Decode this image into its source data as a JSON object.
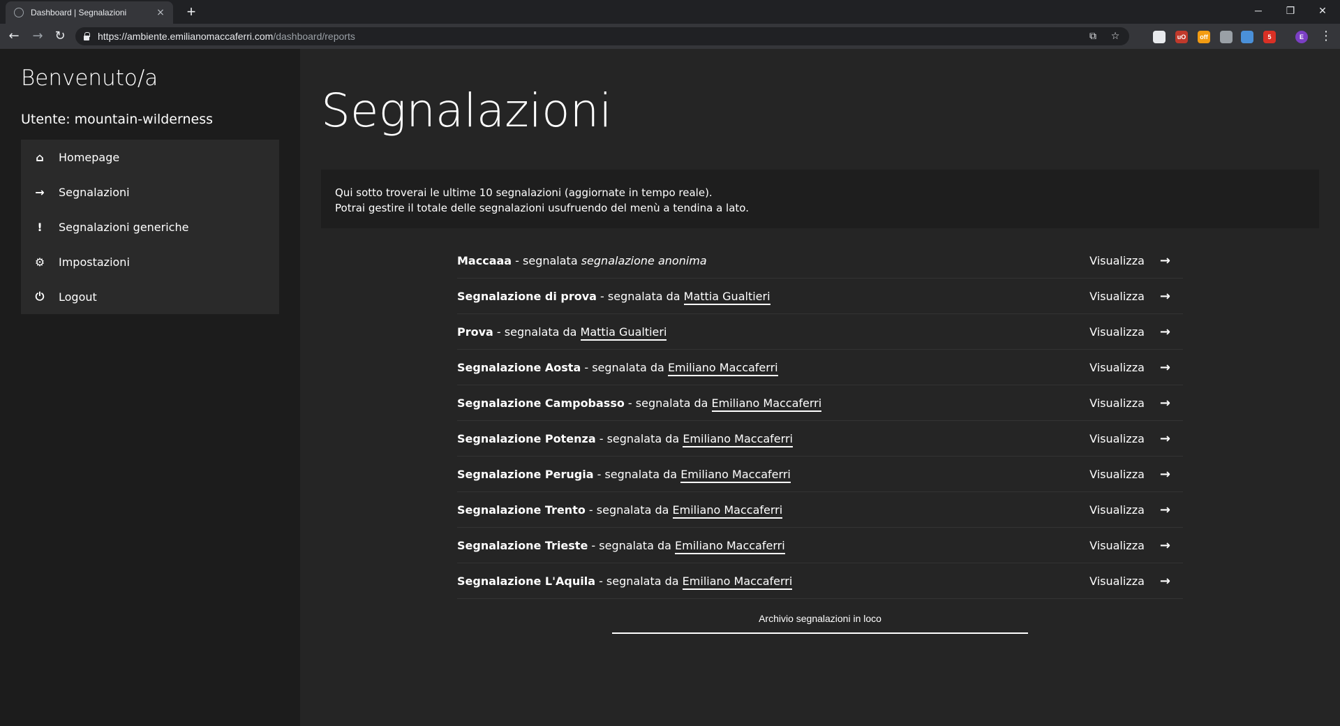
{
  "browser": {
    "tab_title": "Dashboard | Segnalazioni",
    "tab_close": "×",
    "new_tab": "+",
    "url_host": "https://ambiente.emilianomaccaferri.com",
    "url_path": "/dashboard/reports",
    "window_minimize": "─",
    "window_restore": "❐",
    "window_close": "✕",
    "extensions": [
      {
        "label": "",
        "color": "#e8eaed"
      },
      {
        "label": "uO",
        "color": "#c0392b"
      },
      {
        "label": "off",
        "color": "#f39c12"
      },
      {
        "label": "",
        "color": "#9aa0a6"
      },
      {
        "label": "",
        "color": "#4a90d9"
      },
      {
        "label": "5",
        "color": "#d93025"
      },
      {
        "label": "E",
        "color": "#7b3fc4"
      }
    ]
  },
  "sidebar": {
    "welcome": "Benvenuto/a",
    "user": "Utente: mountain-wilderness",
    "menu": [
      {
        "label": "Homepage",
        "icon": "⌂"
      },
      {
        "label": "Segnalazioni",
        "icon": "→"
      },
      {
        "label": "Segnalazioni generiche",
        "icon": "!"
      },
      {
        "label": "Impostazioni",
        "icon": "⚙"
      },
      {
        "label": "Logout",
        "icon": "⏻"
      }
    ]
  },
  "main": {
    "title": "Segnalazioni",
    "intro_line1": "Qui sotto troverai le ultime 10 segnalazioni (aggiornate in tempo reale).",
    "intro_line2": "Potrai gestire il totale delle segnalazioni usufruendo del menù a tendina a lato.",
    "view_label": "Visualizza",
    "reports": [
      {
        "name": "Maccaaa",
        "by": " - segnalata ",
        "author": "segnalazione anonima",
        "anonymous": true
      },
      {
        "name": "Segnalazione di prova",
        "by": " - segnalata da ",
        "author": "Mattia Gualtieri",
        "anonymous": false
      },
      {
        "name": "Prova",
        "by": " - segnalata da ",
        "author": "Mattia Gualtieri",
        "anonymous": false
      },
      {
        "name": "Segnalazione Aosta",
        "by": " - segnalata da ",
        "author": "Emiliano Maccaferri",
        "anonymous": false
      },
      {
        "name": "Segnalazione Campobasso",
        "by": " - segnalata da ",
        "author": "Emiliano Maccaferri",
        "anonymous": false
      },
      {
        "name": "Segnalazione Potenza",
        "by": " - segnalata da ",
        "author": "Emiliano Maccaferri",
        "anonymous": false
      },
      {
        "name": "Segnalazione Perugia",
        "by": " - segnalata da ",
        "author": "Emiliano Maccaferri",
        "anonymous": false
      },
      {
        "name": "Segnalazione Trento",
        "by": " - segnalata da ",
        "author": "Emiliano Maccaferri",
        "anonymous": false
      },
      {
        "name": "Segnalazione Trieste",
        "by": " - segnalata da ",
        "author": "Emiliano Maccaferri",
        "anonymous": false
      },
      {
        "name": "Segnalazione L'Aquila",
        "by": " - segnalata da ",
        "author": "Emiliano Maccaferri",
        "anonymous": false
      }
    ],
    "archive_link": "Archivio segnalazioni in loco"
  }
}
